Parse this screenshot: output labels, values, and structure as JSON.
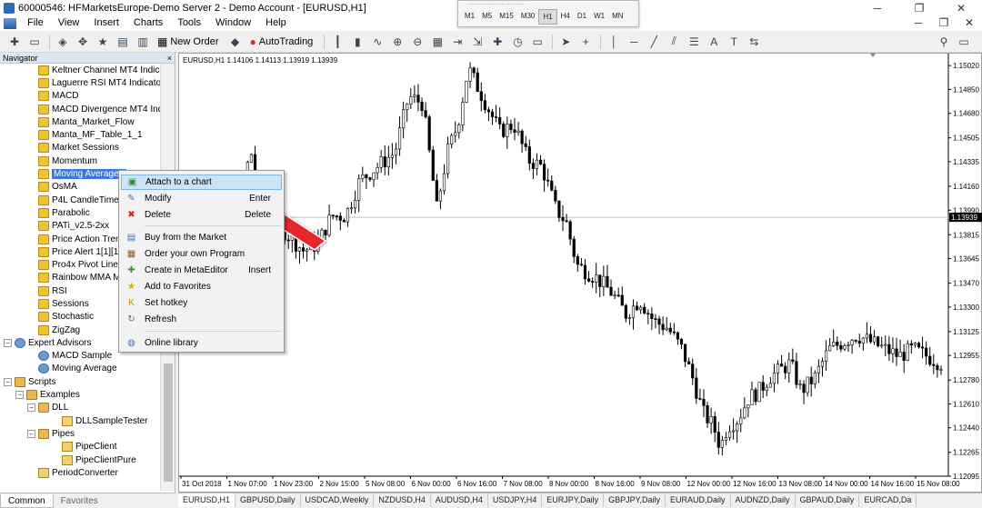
{
  "window": {
    "title": "60000546: HFMarketsEurope-Demo Server 2 - Demo Account - [EURUSD,H1]",
    "controls": [
      "─",
      "❐",
      "✕"
    ]
  },
  "menu": {
    "items": [
      "File",
      "View",
      "Insert",
      "Charts",
      "Tools",
      "Window",
      "Help"
    ],
    "right_controls": [
      "─",
      "❐",
      "✕"
    ]
  },
  "timeframes": {
    "items": [
      "M1",
      "M5",
      "M15",
      "M30",
      "H1",
      "H4",
      "D1",
      "W1",
      "MN"
    ],
    "active": "H1"
  },
  "toolbar": {
    "new_order": "New Order",
    "autotrading": "AutoTrading"
  },
  "navigator": {
    "title": "Navigator",
    "close": "×",
    "items": [
      {
        "label": "Keltner Channel MT4 Indicat",
        "type": "indicator",
        "level": 3
      },
      {
        "label": "Laguerre RSI MT4 Indicator",
        "type": "indicator",
        "level": 3
      },
      {
        "label": "MACD",
        "type": "indicator",
        "level": 3
      },
      {
        "label": "MACD Divergence MT4 Indic",
        "type": "indicator",
        "level": 3
      },
      {
        "label": "Manta_Market_Flow",
        "type": "indicator",
        "level": 3
      },
      {
        "label": "Manta_MF_Table_1_1",
        "type": "indicator",
        "level": 3
      },
      {
        "label": "Market Sessions",
        "type": "indicator",
        "level": 3
      },
      {
        "label": "Momentum",
        "type": "indicator",
        "level": 3
      },
      {
        "label": "Moving Average (",
        "type": "indicator",
        "level": 3,
        "selected": true
      },
      {
        "label": "OsMA",
        "type": "indicator",
        "level": 3
      },
      {
        "label": "P4L CandleTime",
        "type": "indicator",
        "level": 3
      },
      {
        "label": "Parabolic",
        "type": "indicator",
        "level": 3
      },
      {
        "label": "PATi_v2.5-2xx",
        "type": "indicator",
        "level": 3
      },
      {
        "label": "Price Action Trend",
        "type": "indicator",
        "level": 3
      },
      {
        "label": "Price Alert 1[1][1].",
        "type": "indicator",
        "level": 3
      },
      {
        "label": "Pro4x Pivot Lines",
        "type": "indicator",
        "level": 3
      },
      {
        "label": "Rainbow MMA M",
        "type": "indicator",
        "level": 3
      },
      {
        "label": "RSI",
        "type": "indicator",
        "level": 3
      },
      {
        "label": "Sessions",
        "type": "indicator",
        "level": 3
      },
      {
        "label": "Stochastic",
        "type": "indicator",
        "level": 3
      },
      {
        "label": "ZigZag",
        "type": "indicator",
        "level": 3
      },
      {
        "label": "Expert Advisors",
        "type": "ea-folder",
        "level": 1,
        "expander": "−"
      },
      {
        "label": "MACD Sample",
        "type": "ea",
        "level": 3
      },
      {
        "label": "Moving Average",
        "type": "ea",
        "level": 3
      },
      {
        "label": "Scripts",
        "type": "folder",
        "level": 1,
        "expander": "−"
      },
      {
        "label": "Examples",
        "type": "folder",
        "level": 2,
        "expander": "−"
      },
      {
        "label": "DLL",
        "type": "folder",
        "level": 3,
        "expander": "−"
      },
      {
        "label": "DLLSampleTester",
        "type": "script",
        "level": 5
      },
      {
        "label": "Pipes",
        "type": "folder",
        "level": 3,
        "expander": "−"
      },
      {
        "label": "PipeClient",
        "type": "script",
        "level": 5
      },
      {
        "label": "PipeClientPure",
        "type": "script",
        "level": 5
      },
      {
        "label": "PeriodConverter",
        "type": "script",
        "level": 3
      }
    ],
    "tabs": [
      "Common",
      "Favorites"
    ]
  },
  "context_menu": {
    "items": [
      {
        "label": "Attach to a chart",
        "shortcut": "",
        "icon": "attach-icon",
        "color": "#2e8b2e",
        "glyph": "▣",
        "highlight": true
      },
      {
        "label": "Modify",
        "shortcut": "Enter",
        "icon": "modify-icon",
        "color": "#3a74c4",
        "glyph": "✎"
      },
      {
        "label": "Delete",
        "shortcut": "Delete",
        "icon": "delete-icon",
        "color": "#d42020",
        "glyph": "✖"
      },
      {
        "label": "Buy from the Market",
        "shortcut": "",
        "icon": "market-icon",
        "color": "#3a74c4",
        "glyph": "▤"
      },
      {
        "label": "Order your own Program",
        "shortcut": "",
        "icon": "order-icon",
        "color": "#8a5a2a",
        "glyph": "▦"
      },
      {
        "label": "Create in MetaEditor",
        "shortcut": "Insert",
        "icon": "create-icon",
        "color": "#2e9b2e",
        "glyph": "✚"
      },
      {
        "label": "Add to Favorites",
        "shortcut": "",
        "icon": "favorites-icon",
        "color": "#e0a400",
        "glyph": "★"
      },
      {
        "label": "Set hotkey",
        "shortcut": "",
        "icon": "hotkey-icon",
        "color": "#c98b00",
        "glyph": "K"
      },
      {
        "label": "Refresh",
        "shortcut": "",
        "icon": "refresh-icon",
        "color": "#3a74c4",
        "glyph": "↻"
      },
      {
        "label": "Online library",
        "shortcut": "",
        "icon": "library-icon",
        "color": "#3a74c4",
        "glyph": "◍"
      }
    ]
  },
  "chart": {
    "info": "EURUSD,H1  1.14106 1.14113 1.13919 1.13939",
    "current_price": "1.13939",
    "price_ticks": [
      "1.15020",
      "1.14850",
      "1.14680",
      "1.14505",
      "1.14335",
      "1.14160",
      "1.13990",
      "1.13815",
      "1.13645",
      "1.13470",
      "1.13300",
      "1.13125",
      "1.12955",
      "1.12780",
      "1.12610",
      "1.12440",
      "1.12265",
      "1.12095"
    ],
    "time_ticks": [
      "31 Oct 2018",
      "1 Nov 07:00",
      "1 Nov 23:00",
      "2 Nov 15:00",
      "5 Nov 08:00",
      "6 Nov 00:00",
      "6 Nov 16:00",
      "7 Nov 08:00",
      "8 Nov 00:00",
      "8 Nov 16:00",
      "9 Nov 08:00",
      "12 Nov 00:00",
      "12 Nov 16:00",
      "13 Nov 08:00",
      "14 Nov 00:00",
      "14 Nov 16:00",
      "15 Nov 08:00"
    ],
    "bull_color": "#ffffff",
    "bear_color": "#000000",
    "price_line_color": "#c0c0c0"
  },
  "chart_data": {
    "type": "candlestick",
    "symbol": "EURUSD,H1",
    "ylim": [
      1.12095,
      1.15105
    ],
    "path": [
      [
        0,
        1.137
      ],
      [
        6,
        1.1345
      ],
      [
        14,
        1.139
      ],
      [
        22,
        1.1372
      ],
      [
        30,
        1.1405
      ],
      [
        38,
        1.144
      ],
      [
        46,
        1.1385
      ],
      [
        52,
        1.139
      ],
      [
        60,
        1.138
      ],
      [
        68,
        1.137
      ],
      [
        76,
        1.1375
      ],
      [
        84,
        1.1395
      ],
      [
        92,
        1.1395
      ],
      [
        100,
        1.142
      ],
      [
        110,
        1.143
      ],
      [
        120,
        1.144
      ],
      [
        128,
        1.148
      ],
      [
        136,
        1.1475
      ],
      [
        144,
        1.14
      ],
      [
        150,
        1.144
      ],
      [
        156,
        1.146
      ],
      [
        162,
        1.15
      ],
      [
        168,
        1.1485
      ],
      [
        174,
        1.147
      ],
      [
        180,
        1.1455
      ],
      [
        188,
        1.146
      ],
      [
        196,
        1.1435
      ],
      [
        204,
        1.143
      ],
      [
        212,
        1.14
      ],
      [
        218,
        1.139
      ],
      [
        224,
        1.136
      ],
      [
        230,
        1.1355
      ],
      [
        236,
        1.135
      ],
      [
        244,
        1.134
      ],
      [
        252,
        1.1325
      ],
      [
        260,
        1.1335
      ],
      [
        268,
        1.132
      ],
      [
        276,
        1.1315
      ],
      [
        284,
        1.13
      ],
      [
        290,
        1.128
      ],
      [
        296,
        1.1255
      ],
      [
        302,
        1.1245
      ],
      [
        306,
        1.123
      ],
      [
        310,
        1.1245
      ],
      [
        316,
        1.125
      ],
      [
        322,
        1.1265
      ],
      [
        328,
        1.127
      ],
      [
        334,
        1.128
      ],
      [
        340,
        1.1285
      ],
      [
        346,
        1.129
      ],
      [
        352,
        1.127
      ],
      [
        360,
        1.128
      ],
      [
        368,
        1.13
      ],
      [
        376,
        1.1305
      ],
      [
        384,
        1.131
      ],
      [
        392,
        1.1305
      ],
      [
        400,
        1.13
      ],
      [
        408,
        1.1295
      ],
      [
        416,
        1.13
      ],
      [
        424,
        1.1295
      ],
      [
        432,
        1.129
      ]
    ]
  },
  "bottom_tabs": {
    "items": [
      "EURUSD,H1",
      "GBPUSD,Daily",
      "USDCAD,Weekly",
      "NZDUSD,H4",
      "AUDUSD,H4",
      "USDJPY,H4",
      "EURJPY,Daily",
      "GBPJPY,Daily",
      "EURAUD,Daily",
      "AUDNZD,Daily",
      "GBPAUD,Daily",
      "EURCAD,Da"
    ],
    "active": "EURUSD,H1"
  }
}
